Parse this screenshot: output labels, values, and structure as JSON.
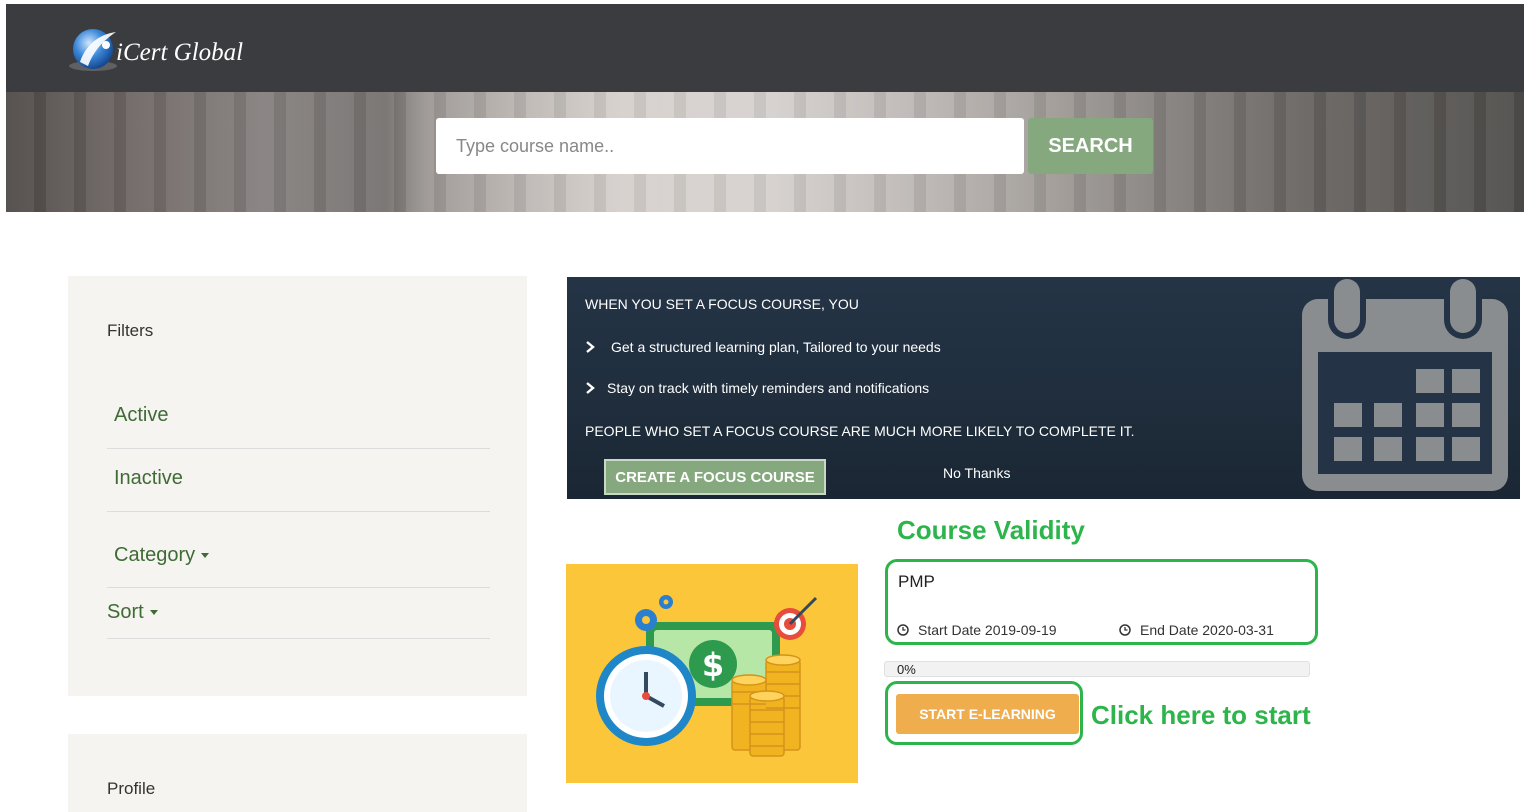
{
  "header": {
    "logo_text": "iCert Global",
    "search_placeholder": "Type course name..",
    "search_button": "SEARCH"
  },
  "sidebar": {
    "filters_title": "Filters",
    "items": [
      {
        "label": "Active"
      },
      {
        "label": "Inactive"
      },
      {
        "label": "Category"
      },
      {
        "label": "Sort"
      }
    ],
    "profile_title": "Profile"
  },
  "focus_banner": {
    "heading": "WHEN YOU SET A FOCUS COURSE, YOU",
    "bullets": [
      "Get a structured learning plan, Tailored to your needs",
      "Stay on track with timely reminders and notifications"
    ],
    "tagline": "PEOPLE WHO SET A FOCUS COURSE ARE MUCH MORE LIKELY TO COMPLETE IT.",
    "create_button": "CREATE A FOCUS COURSE",
    "dismiss": "No Thanks",
    "icon": "calendar-icon"
  },
  "course": {
    "annotation_validity": "Course Validity",
    "name": "PMP",
    "start_date": "Start Date 2019-09-19",
    "end_date": "End Date 2020-03-31",
    "progress_label": "0%",
    "progress_fraction": 0,
    "start_button": "START E-LEARNING",
    "annotation_click": "Click here to start"
  },
  "colors": {
    "topbar": "#3a3c3f",
    "accent_green": "#86a87e",
    "link_green": "#3f6b35",
    "annotation_green": "#2db54b",
    "start_orange": "#f0ad4e",
    "banner_navy": "#243446",
    "course_image_yellow": "#fbc63a"
  }
}
